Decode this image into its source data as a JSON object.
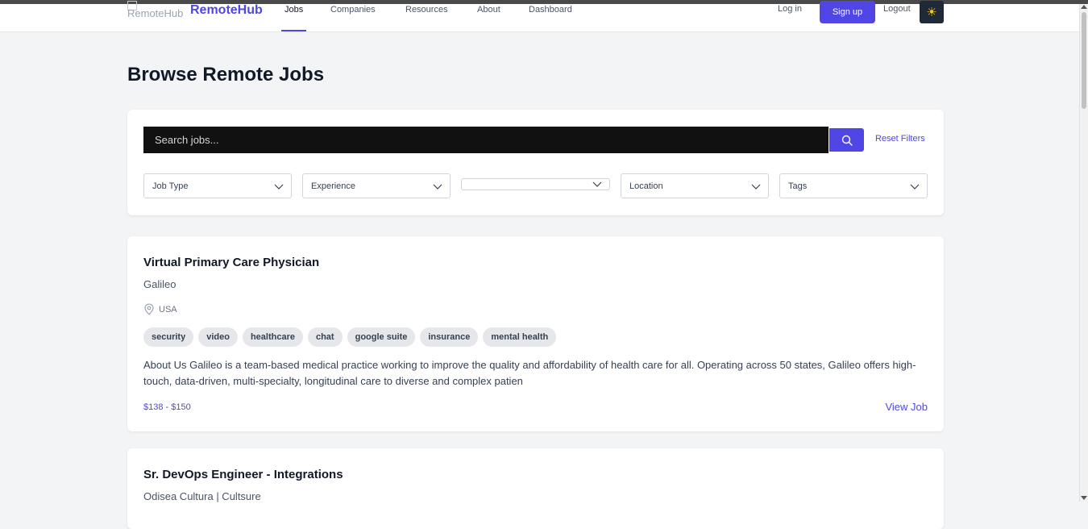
{
  "nav": {
    "logo_alt": "RemoteHub",
    "brand": "RemoteHub",
    "links": [
      "Jobs",
      "Companies",
      "Resources",
      "About",
      "Dashboard"
    ],
    "active_link": "Jobs",
    "login": "Log in",
    "signup": "Sign up",
    "logout": "Logout",
    "theme_icon": "☀"
  },
  "page": {
    "title": "Browse Remote Jobs"
  },
  "filters": {
    "search_placeholder": "Search jobs...",
    "search_value": "",
    "reset_label": "Reset Filters",
    "selects": [
      "Job Type",
      "Experience",
      "",
      "Location",
      "Tags"
    ]
  },
  "jobs": [
    {
      "title": "Virtual Primary Care Physician",
      "company": "Galileo",
      "location": "USA",
      "tags": [
        "security",
        "video",
        "healthcare",
        "chat",
        "google suite",
        "insurance",
        "mental health"
      ],
      "description": "About Us Galileo is a team-based medical practice working to improve the quality and affordability of health care for all. Operating across 50 states, Galileo offers high-touch, data-driven, multi-specialty, longitudinal care to diverse and complex patien",
      "salary": "$138 - $150",
      "view_label": "View Job"
    },
    {
      "title": "Sr. DevOps Engineer - Integrations",
      "company": "Odisea Cultura | Cultsure"
    }
  ],
  "colors": {
    "accent": "#4f46e5",
    "background": "#f3f4f6",
    "search_bg": "#111111",
    "tag_bg": "#e5e7eb"
  },
  "icons": {
    "search": "magnifier",
    "location": "map-pin",
    "theme": "sun",
    "select": "chevron-down"
  }
}
